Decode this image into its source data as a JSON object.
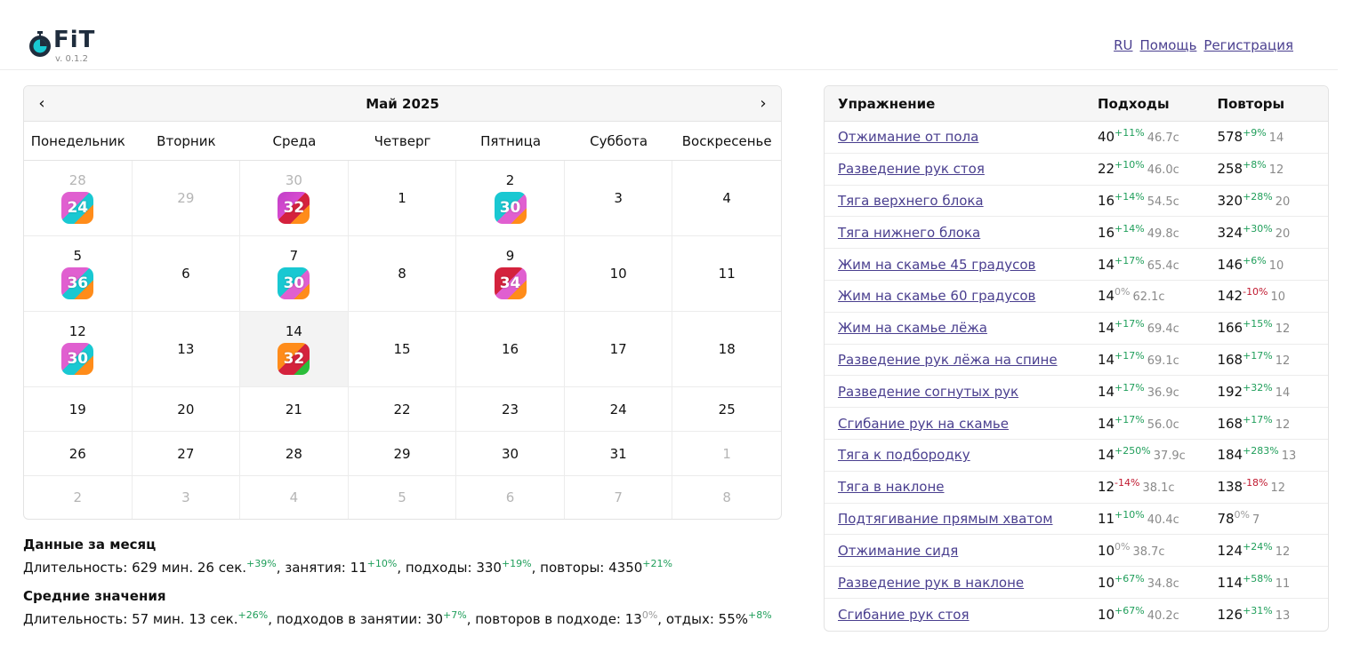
{
  "header": {
    "logo_text": "FiT",
    "version": "v. 0.1.2",
    "nav": [
      "RU",
      "Помощь",
      "Регистрация"
    ]
  },
  "calendar": {
    "title": "Май 2025",
    "weekdays": [
      "Понедельник",
      "Вторник",
      "Среда",
      "Четверг",
      "Пятница",
      "Суббота",
      "Воскресенье"
    ],
    "days": [
      {
        "d": "28",
        "other": true,
        "badge": "24",
        "style": "a"
      },
      {
        "d": "29",
        "other": true
      },
      {
        "d": "30",
        "other": true,
        "badge": "32",
        "style": "b"
      },
      {
        "d": "1"
      },
      {
        "d": "2",
        "badge": "30",
        "style": "c"
      },
      {
        "d": "3"
      },
      {
        "d": "4"
      },
      {
        "d": "5",
        "badge": "36",
        "style": "a"
      },
      {
        "d": "6"
      },
      {
        "d": "7",
        "badge": "30",
        "style": "c"
      },
      {
        "d": "8"
      },
      {
        "d": "9",
        "badge": "34",
        "style": "d"
      },
      {
        "d": "10"
      },
      {
        "d": "11"
      },
      {
        "d": "12",
        "badge": "30",
        "style": "a"
      },
      {
        "d": "13"
      },
      {
        "d": "14",
        "badge": "32",
        "style": "e",
        "today": true
      },
      {
        "d": "15"
      },
      {
        "d": "16"
      },
      {
        "d": "17"
      },
      {
        "d": "18"
      },
      {
        "d": "19"
      },
      {
        "d": "20"
      },
      {
        "d": "21"
      },
      {
        "d": "22"
      },
      {
        "d": "23"
      },
      {
        "d": "24"
      },
      {
        "d": "25"
      },
      {
        "d": "26"
      },
      {
        "d": "27"
      },
      {
        "d": "28"
      },
      {
        "d": "29"
      },
      {
        "d": "30"
      },
      {
        "d": "31"
      },
      {
        "d": "1",
        "other": true
      },
      {
        "d": "2",
        "other": true
      },
      {
        "d": "3",
        "other": true
      },
      {
        "d": "4",
        "other": true
      },
      {
        "d": "5",
        "other": true
      },
      {
        "d": "6",
        "other": true
      },
      {
        "d": "7",
        "other": true
      },
      {
        "d": "8",
        "other": true
      }
    ]
  },
  "summary": {
    "month_title": "Данные за месяц",
    "month_items": [
      {
        "label": "Длительность: 629 мин. 26 сек.",
        "pct": "+39%",
        "trend": "up"
      },
      {
        "label": ", занятия: 11",
        "pct": "+10%",
        "trend": "up"
      },
      {
        "label": ", подходы: 330",
        "pct": "+19%",
        "trend": "up"
      },
      {
        "label": ", повторы: 4350",
        "pct": "+21%",
        "trend": "up"
      }
    ],
    "avg_title": "Средние значения",
    "avg_items": [
      {
        "label": "Длительность: 57 мин. 13 сек.",
        "pct": "+26%",
        "trend": "up"
      },
      {
        "label": ", подходов в занятии: 30",
        "pct": "+7%",
        "trend": "up"
      },
      {
        "label": ", повторов в подходе: 13",
        "pct": "0%",
        "trend": "zero"
      },
      {
        "label": ", отдых: 55%",
        "pct": "+8%",
        "trend": "up"
      }
    ]
  },
  "exercises": {
    "headers": {
      "name": "Упражнение",
      "sets": "Подходы",
      "reps": "Повторы"
    },
    "rows": [
      {
        "name": "Отжимание от пола",
        "sets": "40",
        "sets_pct": "+11%",
        "sets_trend": "up",
        "sets_sub": "46.7с",
        "reps": "578",
        "reps_pct": "+9%",
        "reps_trend": "up",
        "reps_sub": "14"
      },
      {
        "name": "Разведение рук стоя",
        "sets": "22",
        "sets_pct": "+10%",
        "sets_trend": "up",
        "sets_sub": "46.0с",
        "reps": "258",
        "reps_pct": "+8%",
        "reps_trend": "up",
        "reps_sub": "12"
      },
      {
        "name": "Тяга верхнего блока",
        "sets": "16",
        "sets_pct": "+14%",
        "sets_trend": "up",
        "sets_sub": "54.5с",
        "reps": "320",
        "reps_pct": "+28%",
        "reps_trend": "up",
        "reps_sub": "20"
      },
      {
        "name": "Тяга нижнего блока",
        "sets": "16",
        "sets_pct": "+14%",
        "sets_trend": "up",
        "sets_sub": "49.8с",
        "reps": "324",
        "reps_pct": "+30%",
        "reps_trend": "up",
        "reps_sub": "20"
      },
      {
        "name": "Жим на скамье 45 градусов",
        "sets": "14",
        "sets_pct": "+17%",
        "sets_trend": "up",
        "sets_sub": "65.4с",
        "reps": "146",
        "reps_pct": "+6%",
        "reps_trend": "up",
        "reps_sub": "10"
      },
      {
        "name": "Жим на скамье 60 градусов",
        "sets": "14",
        "sets_pct": "0%",
        "sets_trend": "zero",
        "sets_sub": "62.1с",
        "reps": "142",
        "reps_pct": "-10%",
        "reps_trend": "down",
        "reps_sub": "10"
      },
      {
        "name": "Жим на скамье лёжа",
        "sets": "14",
        "sets_pct": "+17%",
        "sets_trend": "up",
        "sets_sub": "69.4с",
        "reps": "166",
        "reps_pct": "+15%",
        "reps_trend": "up",
        "reps_sub": "12"
      },
      {
        "name": "Разведение рук лёжа на спине",
        "sets": "14",
        "sets_pct": "+17%",
        "sets_trend": "up",
        "sets_sub": "69.1с",
        "reps": "168",
        "reps_pct": "+17%",
        "reps_trend": "up",
        "reps_sub": "12"
      },
      {
        "name": "Разведение согнутых рук",
        "sets": "14",
        "sets_pct": "+17%",
        "sets_trend": "up",
        "sets_sub": "36.9с",
        "reps": "192",
        "reps_pct": "+32%",
        "reps_trend": "up",
        "reps_sub": "14"
      },
      {
        "name": "Сгибание рук на скамье",
        "sets": "14",
        "sets_pct": "+17%",
        "sets_trend": "up",
        "sets_sub": "56.0с",
        "reps": "168",
        "reps_pct": "+17%",
        "reps_trend": "up",
        "reps_sub": "12"
      },
      {
        "name": "Тяга к подбородку",
        "sets": "14",
        "sets_pct": "+250%",
        "sets_trend": "up",
        "sets_sub": "37.9с",
        "reps": "184",
        "reps_pct": "+283%",
        "reps_trend": "up",
        "reps_sub": "13"
      },
      {
        "name": "Тяга в наклоне",
        "sets": "12",
        "sets_pct": "-14%",
        "sets_trend": "down",
        "sets_sub": "38.1с",
        "reps": "138",
        "reps_pct": "-18%",
        "reps_trend": "down",
        "reps_sub": "12"
      },
      {
        "name": "Подтягивание прямым хватом",
        "sets": "11",
        "sets_pct": "+10%",
        "sets_trend": "up",
        "sets_sub": "40.4с",
        "reps": "78",
        "reps_pct": "0%",
        "reps_trend": "zero",
        "reps_sub": "7"
      },
      {
        "name": "Отжимание сидя",
        "sets": "10",
        "sets_pct": "0%",
        "sets_trend": "zero",
        "sets_sub": "38.7с",
        "reps": "124",
        "reps_pct": "+24%",
        "reps_trend": "up",
        "reps_sub": "12"
      },
      {
        "name": "Разведение рук в наклоне",
        "sets": "10",
        "sets_pct": "+67%",
        "sets_trend": "up",
        "sets_sub": "34.8с",
        "reps": "114",
        "reps_pct": "+58%",
        "reps_trend": "up",
        "reps_sub": "11"
      },
      {
        "name": "Сгибание рук стоя",
        "sets": "10",
        "sets_pct": "+67%",
        "sets_trend": "up",
        "sets_sub": "40.2с",
        "reps": "126",
        "reps_pct": "+31%",
        "reps_trend": "up",
        "reps_sub": "13"
      }
    ]
  }
}
